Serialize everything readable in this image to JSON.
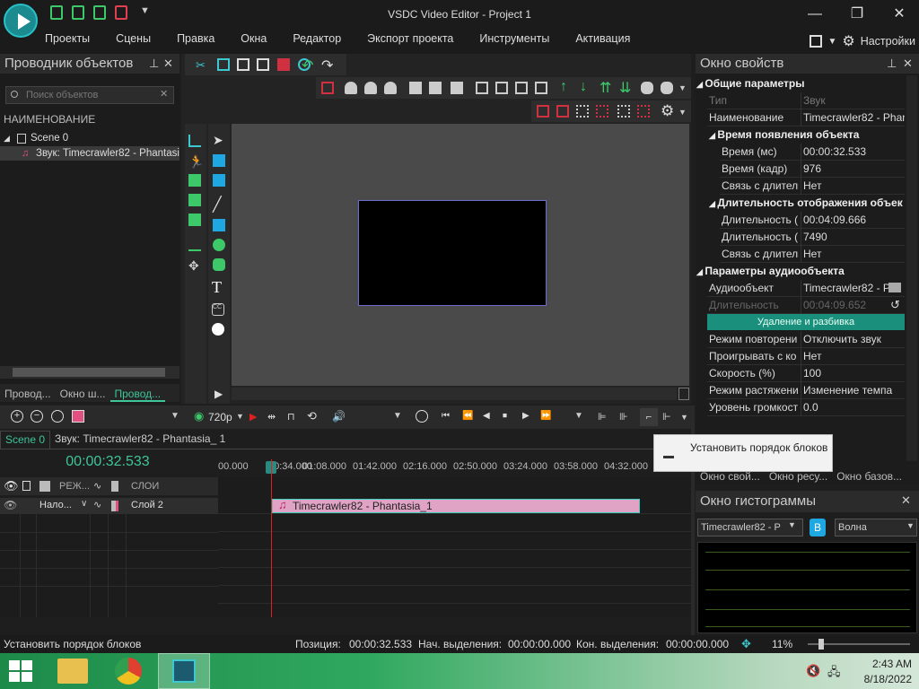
{
  "window": {
    "title": "VSDC Video Editor - Project 1"
  },
  "menu": {
    "items": [
      "Проекты",
      "Сцены",
      "Правка",
      "Окна",
      "Редактор",
      "Экспорт проекта",
      "Инструменты",
      "Активация"
    ],
    "settings_label": "Настройки"
  },
  "explorer": {
    "title": "Проводник объектов",
    "search_placeholder": "Поиск объектов",
    "column_header": "НАИМЕНОВАНИЕ",
    "scene_label": "Scene 0",
    "audio_item": "Звук: Timecrawler82 - Phantasia",
    "tabs": [
      "Провод...",
      "Окно ш...",
      "Провод..."
    ]
  },
  "properties": {
    "title": "Окно свойств",
    "sec_general": "Общие параметры",
    "type_key": "Тип",
    "type_val": "Звук",
    "name_key": "Наименование",
    "name_val": "Timecrawler82 - Phan",
    "sec_appear": "Время появления объекта",
    "t_ms_key": "Время (мс)",
    "t_ms_val": "00:00:32.533",
    "t_frame_key": "Время (кадр)",
    "t_frame_val": "976",
    "t_link_key": "Связь с длитель",
    "t_link_val": "Нет",
    "sec_duration": "Длительность отображения объек",
    "d1_key": "Длительность (",
    "d1_val": "00:04:09.666",
    "d2_key": "Длительность (",
    "d2_val": "7490",
    "d_link_key": "Связь с длитель",
    "d_link_val": "Нет",
    "sec_audio": "Параметры аудиообъекта",
    "a_obj_key": "Аудиообъект",
    "a_obj_val": "Timecrawler82 - P",
    "a_dur_key": "Длительность",
    "a_dur_val": "00:04:09.652",
    "split_button": "Удаление и разбивка",
    "repeat_key": "Режим повторени",
    "repeat_val": "Отключить звук",
    "play_key": "Проигрывать с ко",
    "play_val": "Нет",
    "speed_key": "Скорость (%)",
    "speed_val": "100",
    "stretch_key": "Режим растяжени",
    "stretch_val": "Изменение темпа",
    "volume_key": "Уровень громкост",
    "volume_val": "0.0",
    "tabs": [
      "Окно свой...",
      "Окно ресу...",
      "Окно базов..."
    ]
  },
  "histogram": {
    "title": "Окно гистограммы",
    "source": "Timecrawler82 - P",
    "channel_badge": "B",
    "mode": "Волна"
  },
  "transport": {
    "resolution": "720p"
  },
  "timeline": {
    "tabs": [
      "Scene 0",
      "Звук: Timecrawler82 - Phantasia_ 1"
    ],
    "time": "00:00:32.533",
    "ruler": [
      "00.000",
      "00:34.000",
      "01:08.000",
      "01:42.000",
      "02:16.000",
      "02:50.000",
      "03:24.000",
      "03:58.000",
      "04:32.000"
    ],
    "header_mode": "РЕЖ...",
    "header_layers": "СЛОИ",
    "track_mode": "Нало...",
    "track_layer": "Слой 2",
    "clip_label": "Timecrawler82 - Phantasia_1"
  },
  "tooltip": {
    "text": "Установить порядок блоков"
  },
  "status": {
    "left": "Установить порядок блоков",
    "pos_label": "Позиция:",
    "pos_val": "00:00:32.533",
    "sel_start_label": "Нач. выделения:",
    "sel_start_val": "00:00:00.000",
    "sel_end_label": "Кон. выделения:",
    "sel_end_val": "00:00:00.000",
    "zoom": "11%"
  },
  "taskbar": {
    "time": "2:43 AM",
    "date": "8/18/2022"
  },
  "colors": {
    "accent": "#3ec59a",
    "clip": "#e0a3c6",
    "playhead": "#e02020"
  }
}
